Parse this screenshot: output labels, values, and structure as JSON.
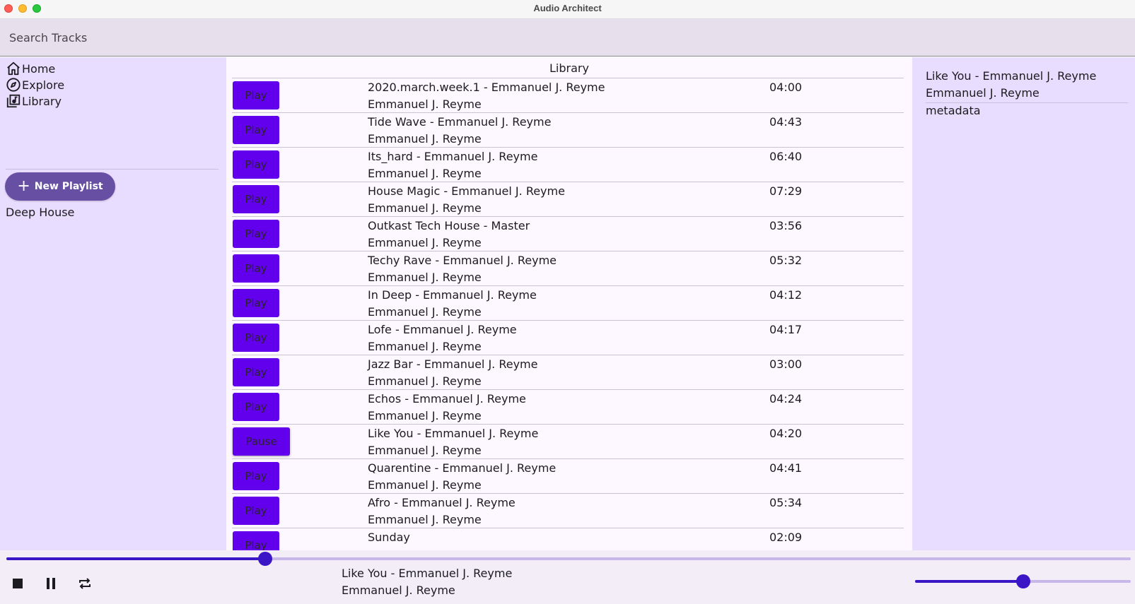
{
  "window": {
    "title": "Audio Architect"
  },
  "search": {
    "placeholder": "Search Tracks"
  },
  "sidebar": {
    "nav": [
      {
        "label": "Home",
        "icon": "home-icon"
      },
      {
        "label": "Explore",
        "icon": "compass-icon"
      },
      {
        "label": "Library",
        "icon": "library-music-icon"
      }
    ],
    "new_playlist_label": "New Playlist",
    "playlists": [
      "Deep House"
    ]
  },
  "library": {
    "title": "Library",
    "tracks": [
      {
        "button": "Play",
        "title": "2020.march.week.1 - Emmanuel J. Reyme",
        "artist": "Emmanuel J. Reyme",
        "duration": "04:00"
      },
      {
        "button": "Play",
        "title": "Tide Wave - Emmanuel J. Reyme",
        "artist": "Emmanuel J. Reyme",
        "duration": "04:43"
      },
      {
        "button": "Play",
        "title": "Its_hard - Emmanuel J. Reyme",
        "artist": "Emmanuel J. Reyme",
        "duration": "06:40"
      },
      {
        "button": "Play",
        "title": "House Magic - Emmanuel J. Reyme",
        "artist": "Emmanuel J. Reyme",
        "duration": "07:29"
      },
      {
        "button": "Play",
        "title": "Outkast Tech House - Master",
        "artist": "Emmanuel J. Reyme",
        "duration": "03:56"
      },
      {
        "button": "Play",
        "title": "Techy Rave - Emmanuel J. Reyme",
        "artist": "Emmanuel J. Reyme",
        "duration": "05:32"
      },
      {
        "button": "Play",
        "title": "In Deep - Emmanuel J. Reyme",
        "artist": "Emmanuel J. Reyme",
        "duration": "04:12"
      },
      {
        "button": "Play",
        "title": "Lofe - Emmanuel J. Reyme",
        "artist": "Emmanuel J. Reyme",
        "duration": "04:17"
      },
      {
        "button": "Play",
        "title": "Jazz Bar - Emmanuel J. Reyme",
        "artist": "Emmanuel J. Reyme",
        "duration": "03:00"
      },
      {
        "button": "Play",
        "title": "Echos - Emmanuel J. Reyme",
        "artist": "Emmanuel J. Reyme",
        "duration": "04:24"
      },
      {
        "button": "Pause",
        "title": "Like You - Emmanuel J. Reyme",
        "artist": "Emmanuel J. Reyme",
        "duration": "04:20"
      },
      {
        "button": "Play",
        "title": "Quarentine - Emmanuel J. Reyme",
        "artist": "Emmanuel J. Reyme",
        "duration": "04:41"
      },
      {
        "button": "Play",
        "title": "Afro - Emmanuel J. Reyme",
        "artist": "Emmanuel J. Reyme",
        "duration": "05:34"
      },
      {
        "button": "Play",
        "title": "Sunday",
        "artist": "",
        "duration": "02:09"
      }
    ]
  },
  "detail": {
    "title": "Like You - Emmanuel J. Reyme",
    "artist": "Emmanuel J. Reyme",
    "metadata_label": "metadata"
  },
  "player": {
    "now_playing_title": "Like You - Emmanuel J. Reyme",
    "now_playing_artist": "Emmanuel J. Reyme",
    "progress_fraction": 0.23,
    "volume_fraction": 0.5,
    "controls": [
      "stop-icon",
      "pause-icon",
      "repeat-icon"
    ]
  },
  "colors": {
    "accent": "#6200ee",
    "primary": "#6750a4",
    "slider": "#3a16c6",
    "sidebar_bg": "#e9ddff"
  }
}
